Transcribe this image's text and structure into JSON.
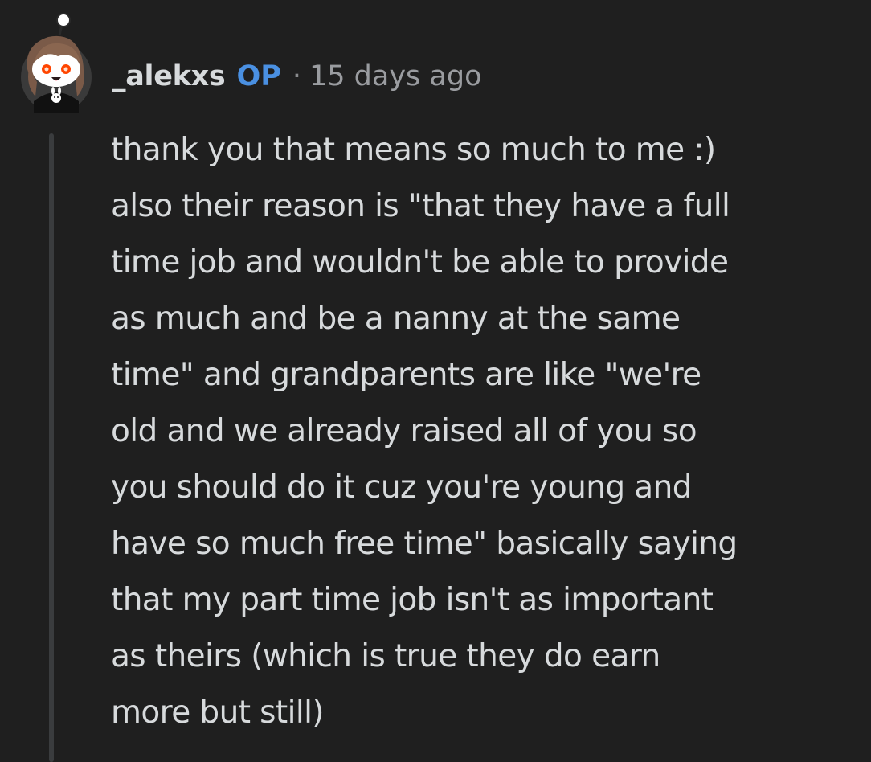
{
  "comment": {
    "author": "_alekxs",
    "op_badge": "OP",
    "separator": "·",
    "timestamp": "15 days ago",
    "avatar_icon": "snoo-avatar-icon",
    "body_lines": [
      "thank you that means so much to me :)",
      "also their reason is \"that they have a full",
      "time job and wouldn't be able to provide",
      "as much and be a nanny at the same",
      "time\" and grandparents are like \"we're",
      "old and we already raised all of you so",
      "you should do it cuz you're young and",
      "have so much free time\" basically saying",
      "that my part time job isn't as important",
      "as theirs (which is true they do earn",
      "more but still)"
    ]
  },
  "colors": {
    "background": "#1f1f1f",
    "text": "#d7dadc",
    "op_badge": "#4a90e2",
    "meta": "#9a9ca0",
    "thread_line": "#3a3c3e"
  }
}
